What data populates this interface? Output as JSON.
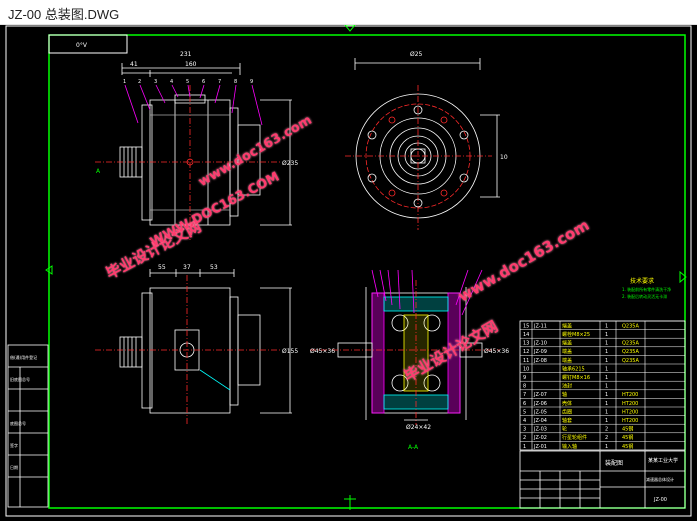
{
  "window": {
    "title": "JZ-00 总装图.DWG"
  },
  "drawing": {
    "corner_label": "0°V",
    "dims": {
      "top_width": "231",
      "left_offset": "41",
      "mid_width": "160",
      "diameter_top": "Ø235",
      "side_dim": "10",
      "front_diameter": "Ø25",
      "lower_a": "55",
      "lower_b": "37",
      "lower_c": "53",
      "lower_diameter": "Ø155",
      "section_label": "A-A",
      "shaft_left": "Ø45×36",
      "shaft_right": "Ø45×36",
      "shaft_bottom": "Ø24×42"
    },
    "notes_title": "技术要求",
    "notes": [
      "1. 装配前所有零件清洗干净",
      "2. 装配后转动灵活无卡滞"
    ],
    "watermarks": [
      "毕业设计论文网",
      "WWW.DOC163.COM",
      "www.doc163.com",
      "毕业设计论文网",
      "www.doc163.com"
    ],
    "bom": [
      {
        "no": "15",
        "code": "JZ-11",
        "name": "端盖",
        "qty": "1",
        "mat": "Q235A"
      },
      {
        "no": "14",
        "code": "",
        "name": "螺栓M8×25",
        "qty": "1",
        "mat": ""
      },
      {
        "no": "13",
        "code": "JZ-10",
        "name": "端盖",
        "qty": "1",
        "mat": "Q235A"
      },
      {
        "no": "12",
        "code": "JZ-09",
        "name": "端盖",
        "qty": "1",
        "mat": "Q235A"
      },
      {
        "no": "11",
        "code": "JZ-08",
        "name": "端盖",
        "qty": "1",
        "mat": "Q235A"
      },
      {
        "no": "10",
        "code": "",
        "name": "轴承6215",
        "qty": "1",
        "mat": ""
      },
      {
        "no": "9",
        "code": "",
        "name": "螺钉M8×16",
        "qty": "1",
        "mat": ""
      },
      {
        "no": "8",
        "code": "",
        "name": "油封",
        "qty": "1",
        "mat": ""
      },
      {
        "no": "7",
        "code": "JZ-07",
        "name": "轴",
        "qty": "1",
        "mat": "HT200"
      },
      {
        "no": "6",
        "code": "JZ-06",
        "name": "壳体",
        "qty": "1",
        "mat": "HT200"
      },
      {
        "no": "5",
        "code": "JZ-05",
        "name": "齿圈",
        "qty": "1",
        "mat": "HT200"
      },
      {
        "no": "4",
        "code": "JZ-04",
        "name": "轴套",
        "qty": "1",
        "mat": "HT200"
      },
      {
        "no": "3",
        "code": "JZ-03",
        "name": "轮",
        "qty": "2",
        "mat": "45钢"
      },
      {
        "no": "2",
        "code": "JZ-02",
        "name": "行星轮组件",
        "qty": "2",
        "mat": "45钢"
      },
      {
        "no": "1",
        "code": "JZ-01",
        "name": "输入轴",
        "qty": "1",
        "mat": "45钢"
      }
    ],
    "title_block": {
      "name": "装配图",
      "school": "某某工业大学",
      "sub": "减速器总体设计",
      "code": "JZ-00"
    },
    "side_block": [
      "借(通)用件登记",
      "旧底图总号",
      "底图总号",
      "签字",
      "日期"
    ]
  },
  "colors": {
    "bg": "#000000",
    "frame": "#ffffff",
    "accent_green": "#00ff00",
    "yellow": "#ffff00",
    "red": "#ff2a2a",
    "magenta": "#ff00ff",
    "cyan": "#00ffff"
  }
}
